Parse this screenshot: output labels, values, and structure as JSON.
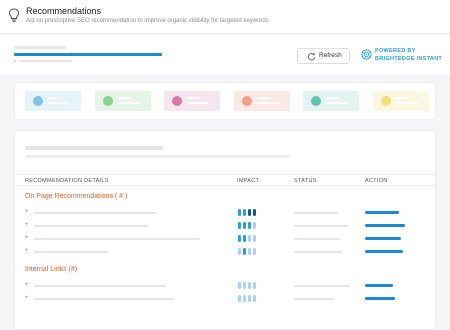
{
  "header": {
    "title": "Recommendations",
    "subtitle": "Act on prescriptive SEO recommendation to improve organic visibility for targeted keywords",
    "icon": "lightbulb-icon"
  },
  "toolbar": {
    "refresh_label": "Refresh",
    "refresh_icon": "refresh-icon",
    "powered_line1": "POWERED BY",
    "powered_line2": "BRIGHTEDGE INSTANT",
    "powered_icon": "brightedge-logo-icon",
    "accent_color": "#1e88d8"
  },
  "cards": [
    {
      "bg": "#e6f3fa",
      "dot": "#7fc3e6"
    },
    {
      "bg": "#e6f4e7",
      "dot": "#8ccf8f"
    },
    {
      "bg": "#f6e6ef",
      "dot": "#d77aaa"
    },
    {
      "bg": "#fbe9e4",
      "dot": "#f2a08a"
    },
    {
      "bg": "#e3f3f0",
      "dot": "#66c1b2"
    },
    {
      "bg": "#fbf7e1",
      "dot": "#f1e07a"
    }
  ],
  "table": {
    "columns": [
      "RECOMMENDATION DETAILS",
      "IMPACT",
      "STATUS",
      "ACTION"
    ],
    "sections": [
      {
        "title": "On Page Recommendations ( # )",
        "rows": 4
      },
      {
        "title": "Internal Links (#)",
        "rows": 2
      }
    ]
  },
  "colors": {
    "section_title": "#e8622a",
    "impact_dark": "#0f5e86",
    "impact_mid": "#2a9fd8",
    "impact_light": "#a9d5ee"
  }
}
